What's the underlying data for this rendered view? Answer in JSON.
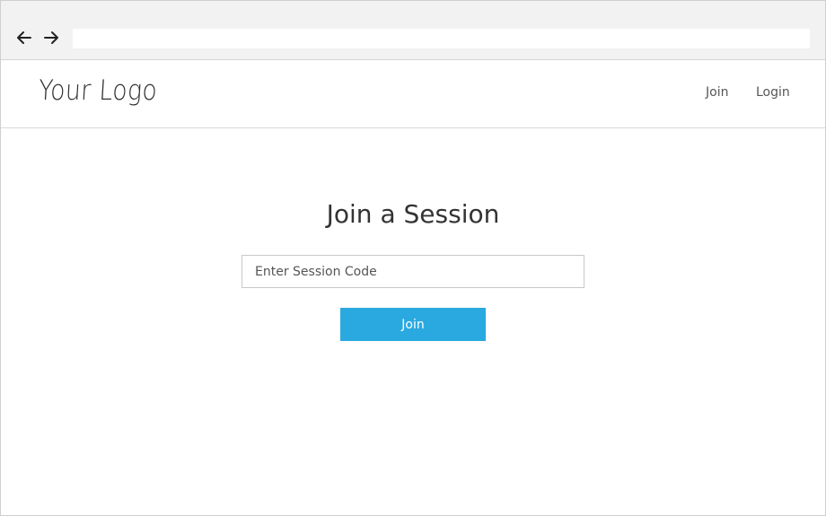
{
  "browser": {
    "back_icon": "arrow-left-icon",
    "forward_icon": "arrow-right-icon",
    "address_value": ""
  },
  "header": {
    "logo_text": "Your Logo",
    "nav": {
      "join_label": "Join",
      "login_label": "Login"
    }
  },
  "main": {
    "title": "Join a Session",
    "session_input": {
      "value": "",
      "placeholder": "Enter Session Code"
    },
    "join_button_label": "Join"
  },
  "colors": {
    "accent": "#2aa9e0",
    "browser_chrome": "#f2f2f2",
    "text": "#333333"
  }
}
